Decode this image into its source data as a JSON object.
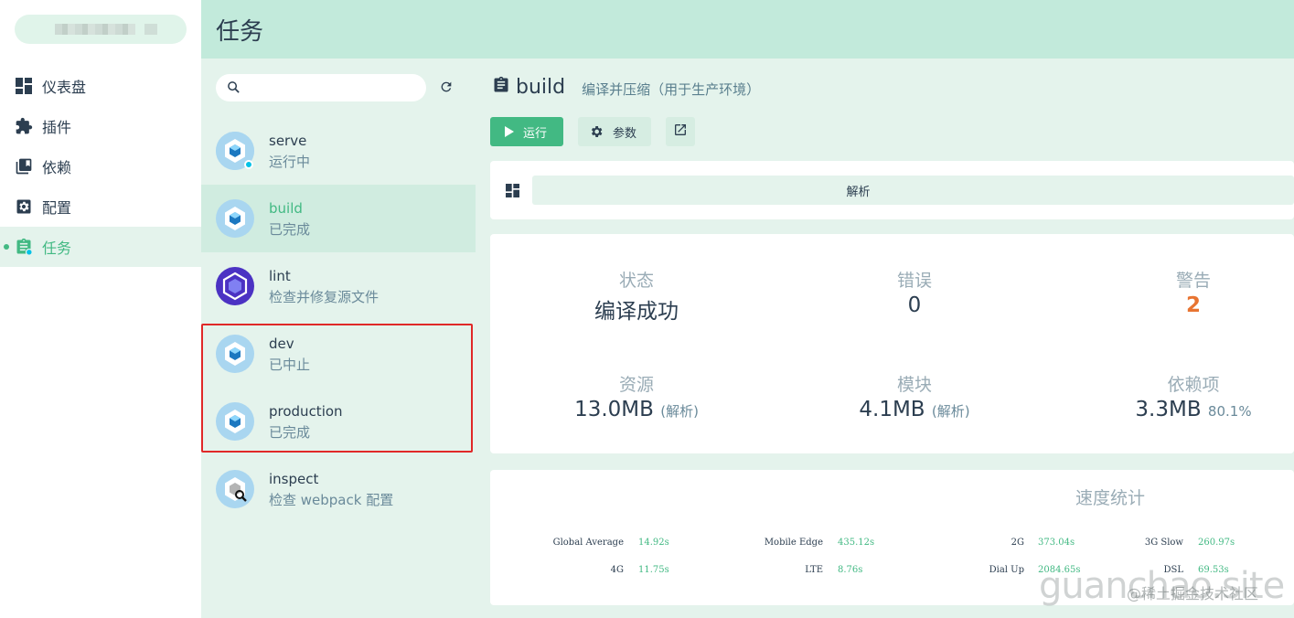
{
  "sidebar": {
    "items": [
      {
        "label": "仪表盘",
        "icon": "dashboard-icon"
      },
      {
        "label": "插件",
        "icon": "puzzle-icon"
      },
      {
        "label": "依赖",
        "icon": "library-books-icon"
      },
      {
        "label": "配置",
        "icon": "settings-applications-icon"
      },
      {
        "label": "任务",
        "icon": "assignment-icon"
      }
    ]
  },
  "header": {
    "title": "任务"
  },
  "tasklist": {
    "tasks": [
      {
        "name": "serve",
        "status": "运行中"
      },
      {
        "name": "build",
        "status": "已完成"
      },
      {
        "name": "lint",
        "status": "检查并修复源文件"
      },
      {
        "name": "dev",
        "status": "已中止"
      },
      {
        "name": "production",
        "status": "已完成"
      },
      {
        "name": "inspect",
        "status": "检查 webpack 配置"
      }
    ]
  },
  "main": {
    "task_name": "build",
    "task_desc": "编译并压缩（用于生产环境）",
    "run_label": "运行",
    "params_label": "参数",
    "tab_label": "解析",
    "stats": {
      "status_label": "状态",
      "status_value": "编译成功",
      "errors_label": "错误",
      "errors_value": "0",
      "warnings_label": "警告",
      "warnings_value": "2",
      "assets_label": "资源",
      "assets_value": "13.0MB",
      "assets_sub": "(解析)",
      "modules_label": "模块",
      "modules_value": "4.1MB",
      "modules_sub": "(解析)",
      "deps_label": "依赖项",
      "deps_value": "3.3MB",
      "deps_sub": "80.1%"
    },
    "speed": {
      "title": "速度统计",
      "global_average_label": "Global Average",
      "global_average": "14.92s",
      "mobile_edge_label": "Mobile Edge",
      "mobile_edge": "435.12s",
      "g2_label": "2G",
      "g2": "373.04s",
      "g3_slow_label": "3G Slow",
      "g3_slow": "260.97s",
      "g4_label": "4G",
      "g4": "11.75s",
      "lte_label": "LTE",
      "lte": "8.76s",
      "dial_up_label": "Dial Up",
      "dial_up": "2084.65s",
      "dsl_label": "DSL",
      "dsl": "69.53s"
    }
  },
  "watermark": {
    "text": "guanchao.site",
    "text2": "@稀土掘金技术社区"
  },
  "colors": {
    "accent": "#42b983",
    "warning": "#e87431",
    "header": "#c2eadb",
    "highlight": "#e02828"
  }
}
